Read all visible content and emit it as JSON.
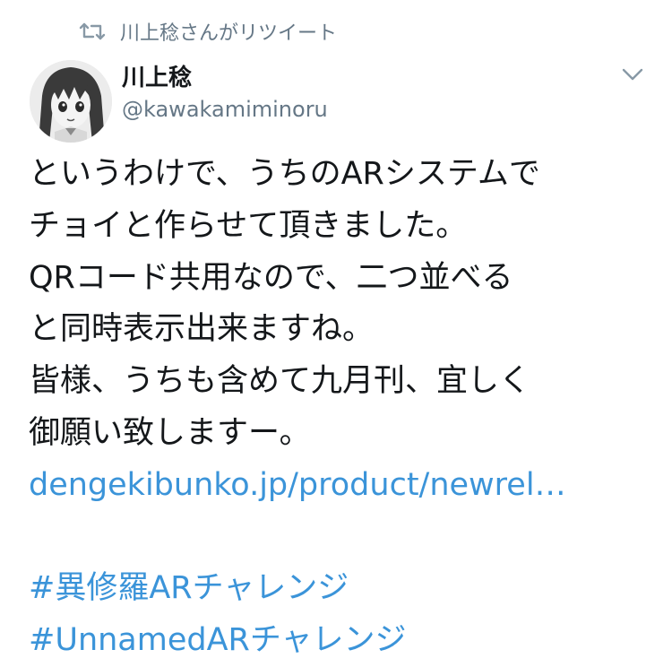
{
  "retweet": {
    "icon": "retweet-icon",
    "text": "川上稔さんがリツイート"
  },
  "author": {
    "display_name": "川上稔",
    "screen_name": "@kawakamiminoru",
    "avatar_icon": "avatar-anime-character"
  },
  "caret_icon": "chevron-down-icon",
  "tweet": {
    "lines": [
      "というわけで、うちのARシステムで",
      "チョイと作らせて頂きました。",
      "QRコード共用なので、二つ並べる",
      "と同時表示出来ますね。",
      "皆様、うちも含めて九月刊、宜しく",
      "御願い致しますー。"
    ],
    "link": "dengekibunko.jp/product/newrel…",
    "hashtags": [
      "#異修羅ARチャレンジ",
      "#UnnamedARチャレンジ"
    ]
  },
  "colors": {
    "text": "#14171a",
    "muted": "#657786",
    "link": "#3b94d9",
    "background": "#ffffff"
  }
}
